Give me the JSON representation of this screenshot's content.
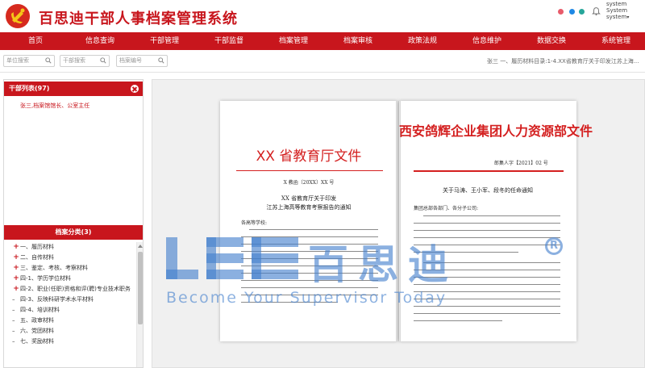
{
  "app": {
    "title": "百思迪干部人事档案管理系统",
    "user_lines": [
      "system",
      "System",
      "system"
    ],
    "accent_color": "#c8161d"
  },
  "nav": {
    "items": [
      "首页",
      "信息查询",
      "干部管理",
      "干部监督",
      "档案管理",
      "档案审核",
      "政策法规",
      "信息维护",
      "数据交换",
      "系统管理"
    ]
  },
  "search": {
    "unit_placeholder": "单位搜索",
    "cadre_placeholder": "干部搜索",
    "archive_placeholder": "档案编号"
  },
  "breadcrumb": "张三 一、履历材料目录:1-4.XX省教育厅关于印发江苏上海...",
  "cadre_panel": {
    "title": "干部列表(97)",
    "items": [
      "张三,档案馆馆长、公室主任"
    ]
  },
  "category_panel": {
    "title": "档案分类(3)",
    "items": [
      {
        "label": "一、履历材料",
        "expandable": true
      },
      {
        "label": "二、自传材料",
        "expandable": true
      },
      {
        "label": "三、鉴定、考核、考察材料",
        "expandable": true
      },
      {
        "label": "四-1、学历学位材料",
        "expandable": true
      },
      {
        "label": "四-2、职业(任职)资格和评(聘)专业技术职务",
        "expandable": true
      },
      {
        "label": "四-3、反映科研学术水平材料",
        "expandable": false
      },
      {
        "label": "四-4、培训材料",
        "expandable": false
      },
      {
        "label": "五、政审材料",
        "expandable": false
      },
      {
        "label": "六、党团材料",
        "expandable": false
      },
      {
        "label": "七、奖励材料",
        "expandable": false
      }
    ]
  },
  "document": {
    "left_header": "XX 省教育厅文件",
    "left_doc_no": "X 教函〔20XX〕XX 号",
    "left_title_1": "XX 省教育厅关于印发",
    "left_title_2": "江苏上海高等教育考察报告的通知",
    "left_salutation": "各高等学校:",
    "right_header": "西安鸽辉企业集团人力资源部文件",
    "right_doc_no": "郎集人字【2021】02 号",
    "right_title": "关于马涛、王小军、段冬的任命通知",
    "right_salutation": "集团总部各部门、各分子公司:"
  },
  "watermark": {
    "cn": "百思迪",
    "reg": "R",
    "en": "Become Your Supervisor Today"
  }
}
